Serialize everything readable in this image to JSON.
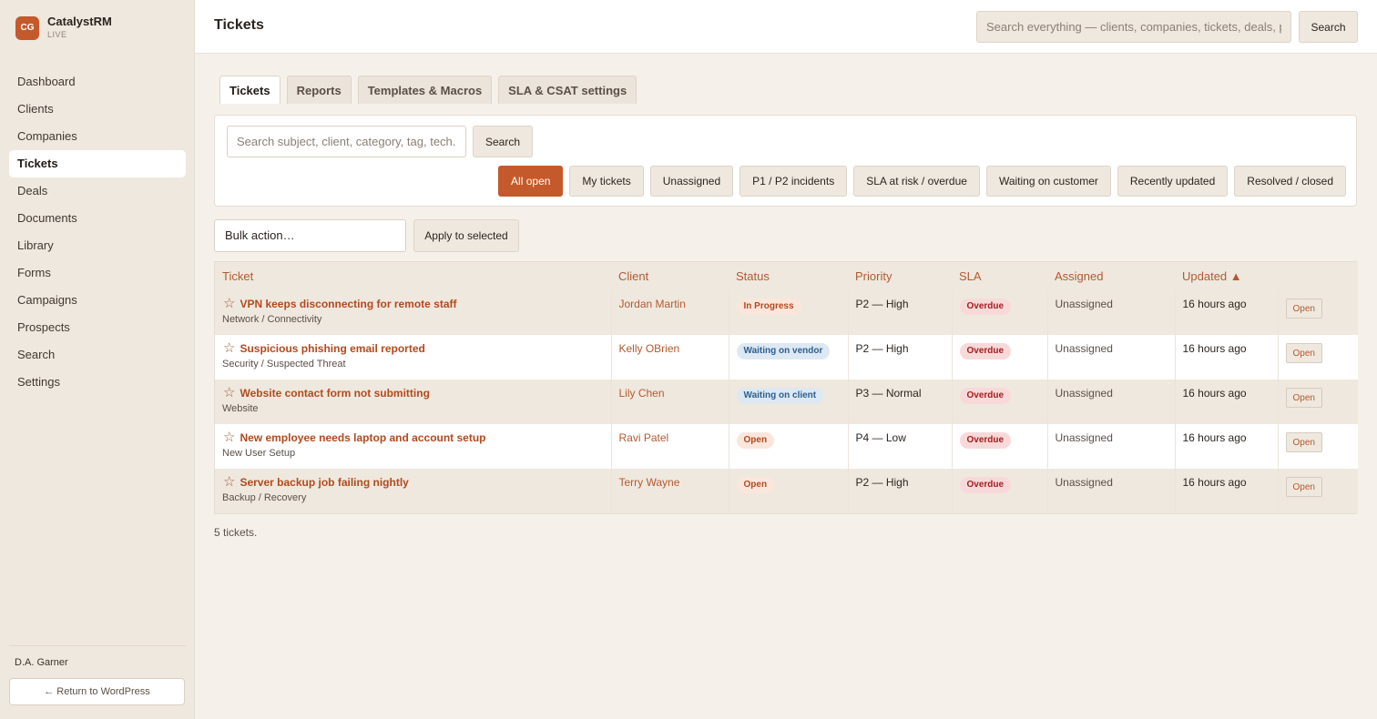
{
  "brand": {
    "initials": "CG",
    "name": "CatalystRM",
    "status": "LIVE"
  },
  "nav": [
    {
      "label": "Dashboard",
      "active": false
    },
    {
      "label": "Clients",
      "active": false
    },
    {
      "label": "Companies",
      "active": false
    },
    {
      "label": "Tickets",
      "active": true
    },
    {
      "label": "Deals",
      "active": false
    },
    {
      "label": "Documents",
      "active": false
    },
    {
      "label": "Library",
      "active": false
    },
    {
      "label": "Forms",
      "active": false
    },
    {
      "label": "Campaigns",
      "active": false
    },
    {
      "label": "Prospects",
      "active": false
    },
    {
      "label": "Search",
      "active": false
    },
    {
      "label": "Settings",
      "active": false
    }
  ],
  "user": {
    "name": "D.A. Garner",
    "return_label": "← Return to WordPress"
  },
  "header": {
    "title": "Tickets",
    "search_placeholder": "Search everything — clients, companies, tickets, deals, pr",
    "search_button": "Search"
  },
  "tabs": [
    {
      "label": "Tickets",
      "active": true
    },
    {
      "label": "Reports",
      "active": false
    },
    {
      "label": "Templates & Macros",
      "active": false
    },
    {
      "label": "SLA & CSAT settings",
      "active": false
    }
  ],
  "filter": {
    "search_placeholder": "Search subject, client, category, tag, tech.",
    "search_button": "Search",
    "chips": [
      {
        "label": "All open",
        "active": true
      },
      {
        "label": "My tickets",
        "active": false
      },
      {
        "label": "Unassigned",
        "active": false
      },
      {
        "label": "P1 / P2 incidents",
        "active": false
      },
      {
        "label": "SLA at risk / overdue",
        "active": false
      },
      {
        "label": "Waiting on customer",
        "active": false
      },
      {
        "label": "Recently updated",
        "active": false
      },
      {
        "label": "Resolved / closed",
        "active": false
      }
    ]
  },
  "bulk": {
    "select_label": "Bulk action…",
    "apply_label": "Apply to selected"
  },
  "table": {
    "columns": [
      "Ticket",
      "Client",
      "Status",
      "Priority",
      "SLA",
      "Assigned",
      "Updated ▲",
      ""
    ],
    "rows": [
      {
        "title": "VPN keeps disconnecting for remote staff",
        "category": "Network / Connectivity",
        "client": "Jordan Martin",
        "status": "In Progress",
        "status_kind": "progress",
        "priority": "P2 — High",
        "sla": "Overdue",
        "assigned": "Unassigned",
        "updated": "16 hours ago",
        "action": "Open"
      },
      {
        "title": "Suspicious phishing email reported",
        "category": "Security / Suspected Threat",
        "client": "Kelly OBrien",
        "status": "Waiting on vendor",
        "status_kind": "vendor",
        "priority": "P2 — High",
        "sla": "Overdue",
        "assigned": "Unassigned",
        "updated": "16 hours ago",
        "action": "Open"
      },
      {
        "title": "Website contact form not submitting",
        "category": "Website",
        "client": "Lily Chen",
        "status": "Waiting on client",
        "status_kind": "client",
        "priority": "P3 — Normal",
        "sla": "Overdue",
        "assigned": "Unassigned",
        "updated": "16 hours ago",
        "action": "Open"
      },
      {
        "title": "New employee needs laptop and account setup",
        "category": "New User Setup",
        "client": "Ravi Patel",
        "status": "Open",
        "status_kind": "open",
        "priority": "P4 — Low",
        "sla": "Overdue",
        "assigned": "Unassigned",
        "updated": "16 hours ago",
        "action": "Open"
      },
      {
        "title": "Server backup job failing nightly",
        "category": "Backup / Recovery",
        "client": "Terry Wayne",
        "status": "Open",
        "status_kind": "open",
        "priority": "P2 — High",
        "sla": "Overdue",
        "assigned": "Unassigned",
        "updated": "16 hours ago",
        "action": "Open"
      }
    ]
  },
  "footer": {
    "count_text": "5 tickets."
  },
  "colors": {
    "accent": "#c4592b",
    "link": "#b24a1e",
    "sidebar_bg": "#efe8de",
    "page_bg": "#f5f1ea"
  }
}
